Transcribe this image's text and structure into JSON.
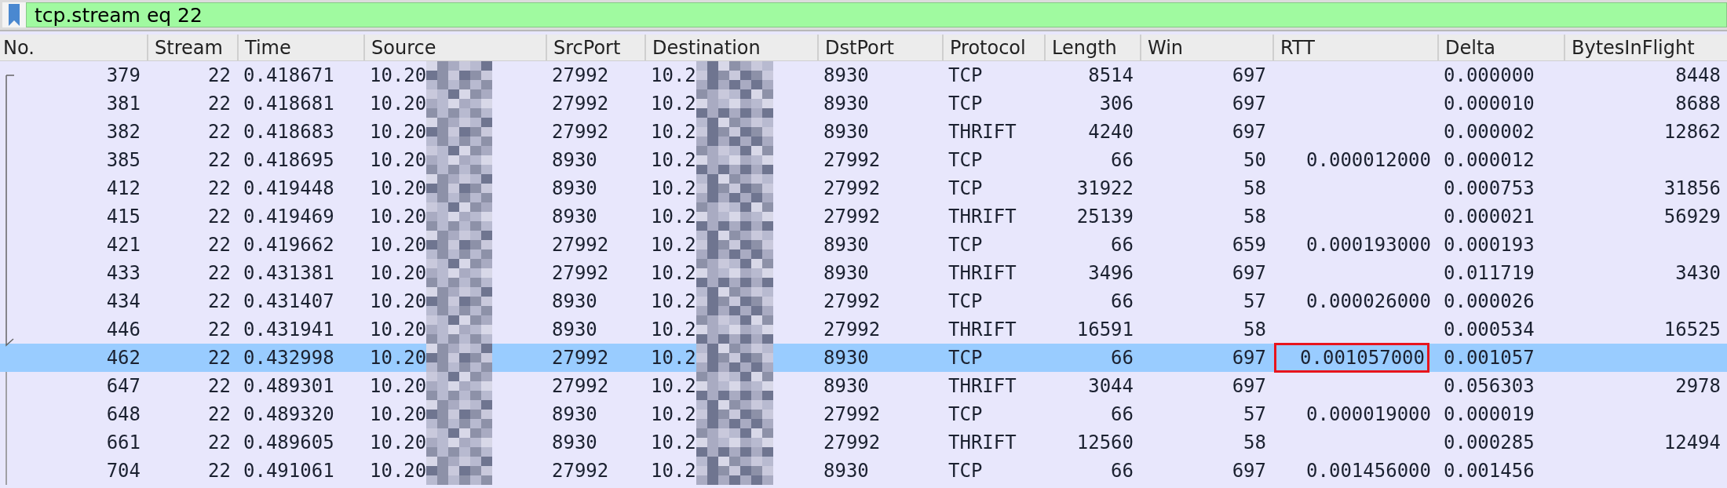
{
  "filter_bar": {
    "value": "tcp.stream eq 22"
  },
  "columns": [
    "No.",
    "Stream",
    "Time",
    "Source",
    "SrcPort",
    "Destination",
    "DstPort",
    "Protocol",
    "Length",
    "Win",
    "RTT",
    "Delta",
    "BytesInFlight"
  ],
  "rows": [
    {
      "no": "379",
      "stream": "22",
      "time": "0.418671",
      "source": "10.20",
      "src_port": "27992",
      "destination": "10.2",
      "dst_port": "8930",
      "protocol": "TCP",
      "length": "8514",
      "win": "697",
      "delta": "0.000000",
      "bytes_in_flight": "8448",
      "selected": false
    },
    {
      "no": "381",
      "stream": "22",
      "time": "0.418681",
      "source": "10.20",
      "src_port": "27992",
      "destination": "10.2",
      "dst_port": "8930",
      "protocol": "TCP",
      "length": "306",
      "win": "697",
      "delta": "0.000010",
      "bytes_in_flight": "8688",
      "selected": false
    },
    {
      "no": "382",
      "stream": "22",
      "time": "0.418683",
      "source": "10.20",
      "src_port": "27992",
      "destination": "10.2",
      "dst_port": "8930",
      "protocol": "THRIFT",
      "length": "4240",
      "win": "697",
      "delta": "0.000002",
      "bytes_in_flight": "12862",
      "selected": false
    },
    {
      "no": "385",
      "stream": "22",
      "time": "0.418695",
      "source": "10.20",
      "src_port": "8930",
      "destination": "10.2",
      "dst_port": "27992",
      "protocol": "TCP",
      "length": "66",
      "win": "50",
      "rtt": "0.000012000",
      "delta": "0.000012",
      "selected": false
    },
    {
      "no": "412",
      "stream": "22",
      "time": "0.419448",
      "source": "10.20",
      "src_port": "8930",
      "destination": "10.2",
      "dst_port": "27992",
      "protocol": "TCP",
      "length": "31922",
      "win": "58",
      "delta": "0.000753",
      "bytes_in_flight": "31856",
      "selected": false
    },
    {
      "no": "415",
      "stream": "22",
      "time": "0.419469",
      "source": "10.20",
      "src_port": "8930",
      "destination": "10.2",
      "dst_port": "27992",
      "protocol": "THRIFT",
      "length": "25139",
      "win": "58",
      "delta": "0.000021",
      "bytes_in_flight": "56929",
      "selected": false
    },
    {
      "no": "421",
      "stream": "22",
      "time": "0.419662",
      "source": "10.20",
      "src_port": "27992",
      "destination": "10.2",
      "dst_port": "8930",
      "protocol": "TCP",
      "length": "66",
      "win": "659",
      "rtt": "0.000193000",
      "delta": "0.000193",
      "selected": false
    },
    {
      "no": "433",
      "stream": "22",
      "time": "0.431381",
      "source": "10.20",
      "src_port": "27992",
      "destination": "10.2",
      "dst_port": "8930",
      "protocol": "THRIFT",
      "length": "3496",
      "win": "697",
      "delta": "0.011719",
      "bytes_in_flight": "3430",
      "selected": false
    },
    {
      "no": "434",
      "stream": "22",
      "time": "0.431407",
      "source": "10.20",
      "src_port": "8930",
      "destination": "10.2",
      "dst_port": "27992",
      "protocol": "TCP",
      "length": "66",
      "win": "57",
      "rtt": "0.000026000",
      "delta": "0.000026",
      "selected": false
    },
    {
      "no": "446",
      "stream": "22",
      "time": "0.431941",
      "source": "10.20",
      "src_port": "8930",
      "destination": "10.2",
      "dst_port": "27992",
      "protocol": "THRIFT",
      "length": "16591",
      "win": "58",
      "delta": "0.000534",
      "bytes_in_flight": "16525",
      "selected": false
    },
    {
      "no": "462",
      "stream": "22",
      "time": "0.432998",
      "source": "10.20",
      "src_port": "27992",
      "destination": "10.2",
      "dst_port": "8930",
      "protocol": "TCP",
      "length": "66",
      "win": "697",
      "rtt": "0.001057000",
      "rtt_boxed": true,
      "delta": "0.001057",
      "selected": true
    },
    {
      "no": "647",
      "stream": "22",
      "time": "0.489301",
      "source": "10.20",
      "src_port": "27992",
      "destination": "10.2",
      "dst_port": "8930",
      "protocol": "THRIFT",
      "length": "3044",
      "win": "697",
      "delta": "0.056303",
      "bytes_in_flight": "2978",
      "selected": false
    },
    {
      "no": "648",
      "stream": "22",
      "time": "0.489320",
      "source": "10.20",
      "src_port": "8930",
      "destination": "10.2",
      "dst_port": "27992",
      "protocol": "TCP",
      "length": "66",
      "win": "57",
      "rtt": "0.000019000",
      "delta": "0.000019",
      "selected": false
    },
    {
      "no": "661",
      "stream": "22",
      "time": "0.489605",
      "source": "10.20",
      "src_port": "8930",
      "destination": "10.2",
      "dst_port": "27992",
      "protocol": "THRIFT",
      "length": "12560",
      "win": "58",
      "delta": "0.000285",
      "bytes_in_flight": "12494",
      "selected": false
    },
    {
      "no": "704",
      "stream": "22",
      "time": "0.491061",
      "source": "10.20",
      "src_port": "27992",
      "destination": "10.2",
      "dst_port": "8930",
      "protocol": "TCP",
      "length": "66",
      "win": "697",
      "rtt": "0.001456000",
      "delta": "0.001456",
      "selected": false
    }
  ]
}
